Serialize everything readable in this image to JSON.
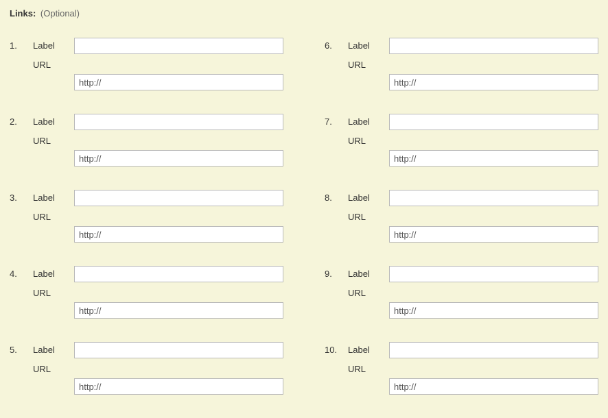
{
  "section": {
    "title": "Links:",
    "note": "(Optional)"
  },
  "labels": {
    "label": "Label",
    "url": "URL"
  },
  "links": [
    {
      "index": "1.",
      "label_value": "",
      "url_value": "http://"
    },
    {
      "index": "2.",
      "label_value": "",
      "url_value": "http://"
    },
    {
      "index": "3.",
      "label_value": "",
      "url_value": "http://"
    },
    {
      "index": "4.",
      "label_value": "",
      "url_value": "http://"
    },
    {
      "index": "5.",
      "label_value": "",
      "url_value": "http://"
    },
    {
      "index": "6.",
      "label_value": "",
      "url_value": "http://"
    },
    {
      "index": "7.",
      "label_value": "",
      "url_value": "http://"
    },
    {
      "index": "8.",
      "label_value": "",
      "url_value": "http://"
    },
    {
      "index": "9.",
      "label_value": "",
      "url_value": "http://"
    },
    {
      "index": "10.",
      "label_value": "",
      "url_value": "http://"
    }
  ]
}
